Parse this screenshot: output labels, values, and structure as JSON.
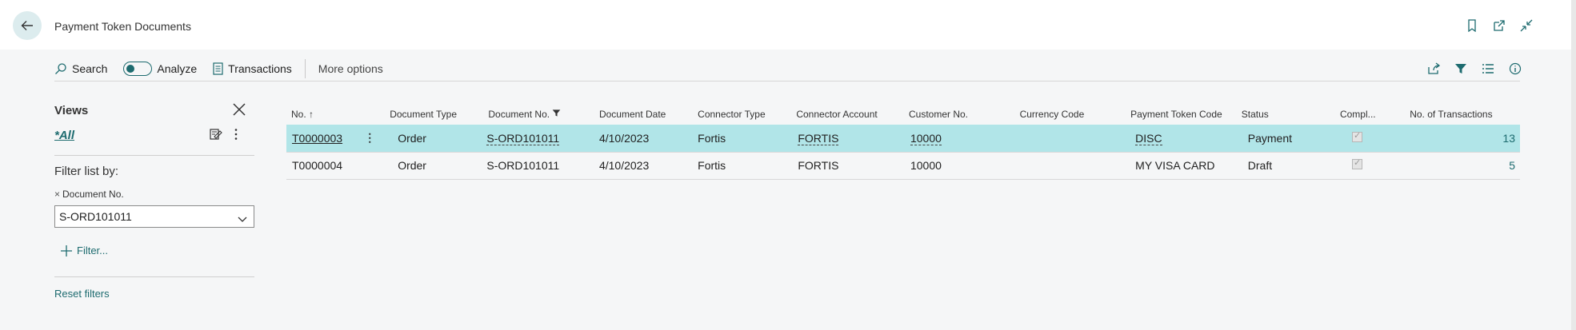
{
  "page": {
    "title": "Payment Token Documents"
  },
  "actionbar": {
    "search_label": "Search",
    "analyze_label": "Analyze",
    "transactions_label": "Transactions",
    "more_options_label": "More options"
  },
  "sidebar": {
    "views_title": "Views",
    "all_view": "*All",
    "filter_list_by": "Filter list by:",
    "filter_field_label": "Document No.",
    "filter_value": "S-ORD101011",
    "add_filter_label": "Filter...",
    "reset_filters_label": "Reset filters"
  },
  "table": {
    "columns": [
      "No. ↑",
      "Document Type",
      "Document No.",
      "Document Date",
      "Connector Type",
      "Connector Account",
      "Customer No.",
      "Currency Code",
      "Payment Token Code",
      "Status",
      "Compl...",
      "No. of Transactions"
    ],
    "rows": [
      {
        "no": "T0000003",
        "doc_type": "Order",
        "doc_no": "S-ORD101011",
        "doc_date": "4/10/2023",
        "connector_type": "Fortis",
        "connector_account": "FORTIS",
        "customer_no": "10000",
        "currency": "",
        "payment_token": "DISC",
        "status": "Payment",
        "completed": true,
        "transactions": "13"
      },
      {
        "no": "T0000004",
        "doc_type": "Order",
        "doc_no": "S-ORD101011",
        "doc_date": "4/10/2023",
        "connector_type": "Fortis",
        "connector_account": "FORTIS",
        "customer_no": "10000",
        "currency": "",
        "payment_token": "MY VISA CARD",
        "status": "Draft",
        "completed": true,
        "transactions": "5"
      }
    ]
  },
  "colors": {
    "accent": "#1d6b6f",
    "selected_row": "#b1e5e8"
  }
}
